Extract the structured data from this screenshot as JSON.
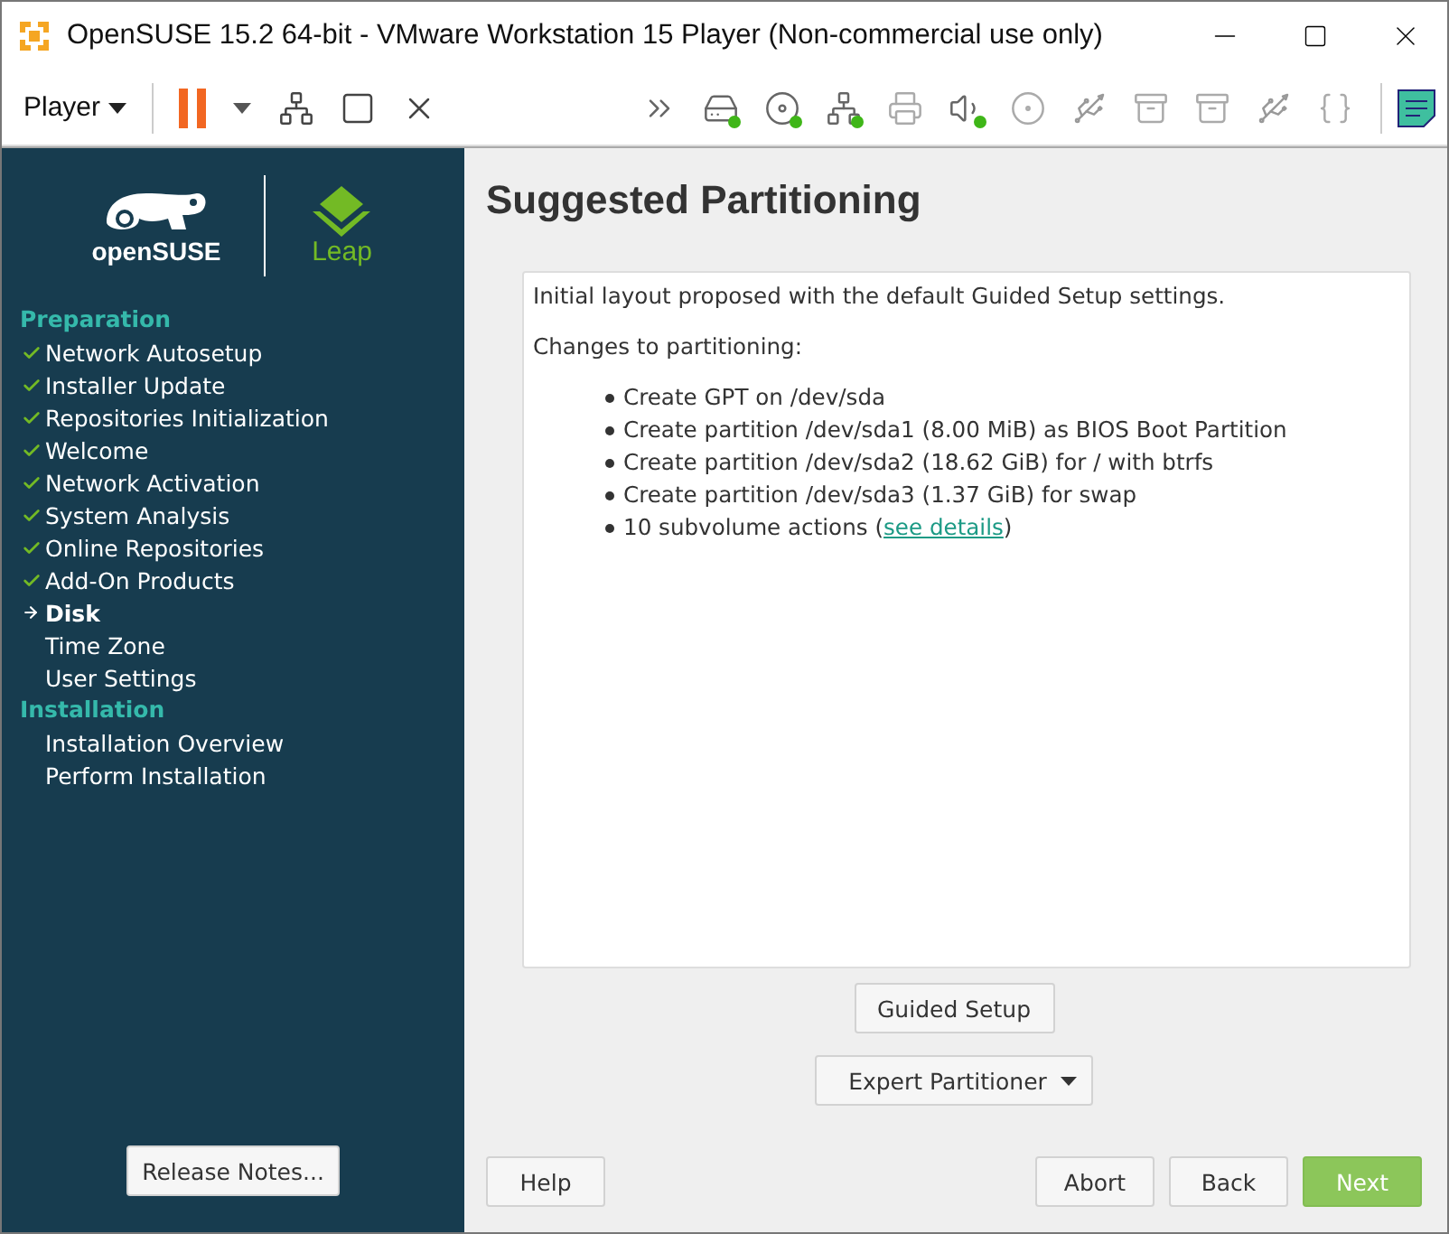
{
  "window": {
    "title": "OpenSUSE 15.2 64-bit  - VMware Workstation 15 Player (Non-commercial use only)"
  },
  "toolbar": {
    "menu": "Player",
    "devices": [
      {
        "kind": "forward",
        "connected": false
      },
      {
        "kind": "disk",
        "connected": true
      },
      {
        "kind": "cd",
        "connected": true
      },
      {
        "kind": "network",
        "connected": true
      },
      {
        "kind": "printer",
        "connected": false
      },
      {
        "kind": "sound",
        "connected": true
      },
      {
        "kind": "camera",
        "connected": false
      },
      {
        "kind": "usb",
        "connected": false
      },
      {
        "kind": "archive",
        "connected": false
      },
      {
        "kind": "archive",
        "connected": false
      },
      {
        "kind": "usb",
        "connected": false
      },
      {
        "kind": "brace",
        "connected": false
      }
    ]
  },
  "sidebar": {
    "logo": {
      "brand": "openSUSE",
      "product": "Leap"
    },
    "sections": [
      {
        "title": "Preparation",
        "steps": [
          {
            "label": "Network Autosetup",
            "done": true,
            "current": false
          },
          {
            "label": "Installer Update",
            "done": true,
            "current": false
          },
          {
            "label": "Repositories Initialization",
            "done": true,
            "current": false
          },
          {
            "label": "Welcome",
            "done": true,
            "current": false
          },
          {
            "label": "Network Activation",
            "done": true,
            "current": false
          },
          {
            "label": "System Analysis",
            "done": true,
            "current": false
          },
          {
            "label": "Online Repositories",
            "done": true,
            "current": false
          },
          {
            "label": "Add-On Products",
            "done": true,
            "current": false
          },
          {
            "label": "Disk",
            "done": false,
            "current": true
          },
          {
            "label": "Time Zone",
            "done": false,
            "current": false
          },
          {
            "label": "User Settings",
            "done": false,
            "current": false
          }
        ]
      },
      {
        "title": "Installation",
        "steps": [
          {
            "label": "Installation Overview",
            "done": false,
            "current": false
          },
          {
            "label": "Perform Installation",
            "done": false,
            "current": false
          }
        ]
      }
    ],
    "release_notes": "Release Notes..."
  },
  "page": {
    "title": "Suggested Partitioning",
    "intro": "Initial layout proposed with the default Guided Setup settings.",
    "changes_heading": "Changes to partitioning:",
    "changes": [
      {
        "text": "Create GPT on /dev/sda"
      },
      {
        "text": "Create partition /dev/sda1 (8.00 MiB) as BIOS Boot Partition"
      },
      {
        "text": "Create partition /dev/sda2 (18.62 GiB) for / with btrfs"
      },
      {
        "text": "Create partition /dev/sda3 (1.37 GiB) for swap"
      },
      {
        "text": "10 subvolume actions (",
        "link": "see details",
        "after": ")"
      }
    ],
    "guided_setup": "Guided Setup",
    "expert_partitioner": "Expert Partitioner"
  },
  "buttons": [
    {
      "label": "Help",
      "kind": "plain"
    },
    {
      "label": "Abort",
      "kind": "plain"
    },
    {
      "label": "Back",
      "kind": "plain"
    },
    {
      "label": "Next",
      "kind": "primary"
    }
  ]
}
